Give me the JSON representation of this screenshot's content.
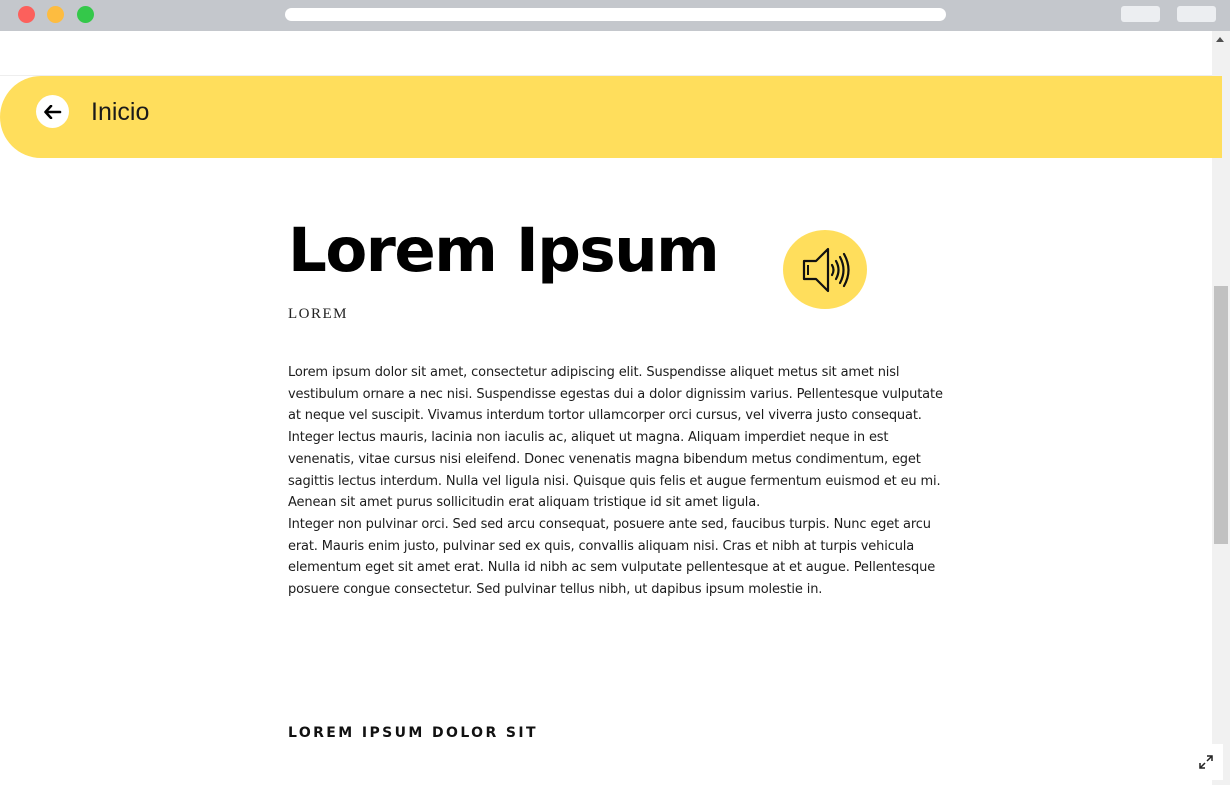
{
  "header": {
    "back_label": "Inicio",
    "back_icon": "arrow-left-icon",
    "accent_color": "#ffde5c"
  },
  "article": {
    "title": "Lorem Ipsum",
    "subtitle": "LOREM",
    "audio_icon": "speaker-icon",
    "paragraphs": [
      "Lorem ipsum dolor sit amet, consectetur adipiscing elit. Suspendisse aliquet metus sit amet nisl vestibulum ornare a nec nisi. Suspendisse egestas dui a dolor dignissim varius. Pellentesque vulputate at neque vel suscipit. Vivamus interdum tortor ullamcorper orci cursus, vel viverra justo consequat. Integer lectus mauris, lacinia non iaculis ac, aliquet ut magna. Aliquam imperdiet neque in est venenatis, vitae cursus nisi eleifend. Donec venenatis magna bibendum metus condimentum, eget sagittis lectus interdum. Nulla vel ligula nisi. Quisque quis felis et augue fermentum euismod et eu mi. Aenean sit amet purus sollicitudin erat aliquam tristique id sit amet ligula.",
      "Integer non pulvinar orci. Sed sed arcu consequat, posuere ante sed, faucibus turpis. Nunc eget arcu erat. Mauris enim justo, pulvinar sed ex quis, convallis aliquam nisi. Cras et nibh at turpis vehicula elementum eget sit amet erat. Nulla id nibh ac sem vulputate pellentesque at et augue. Pellentesque posuere congue consectetur. Sed pulvinar tellus nibh, ut dapibus ipsum molestie in."
    ],
    "section_heading": "LOREM IPSUM DOLOR SIT"
  },
  "controls": {
    "expand_icon": "expand-icon"
  }
}
